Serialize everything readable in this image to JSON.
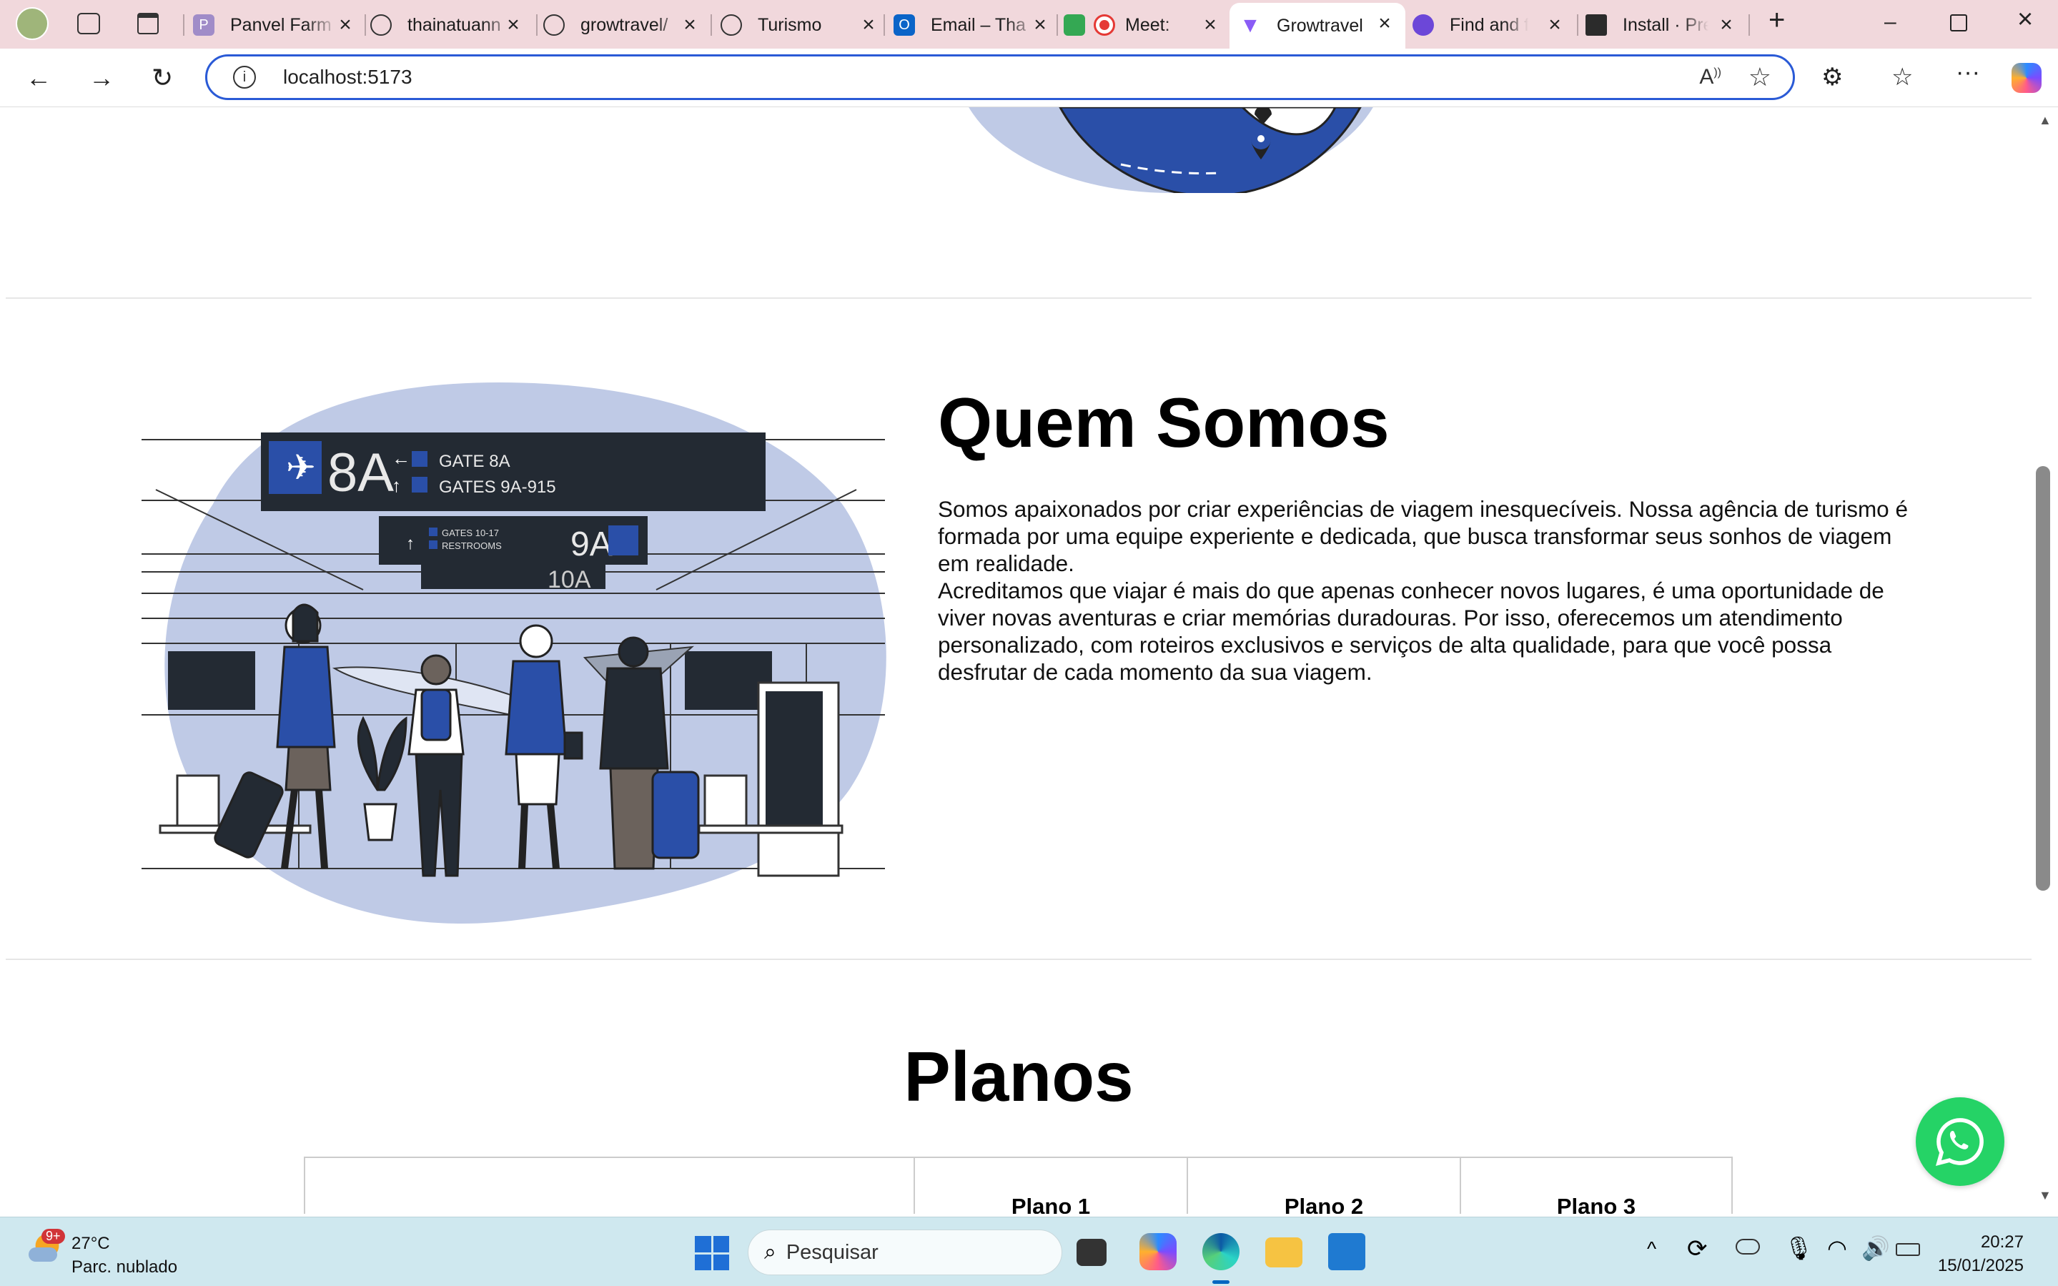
{
  "browser": {
    "tabs": [
      {
        "title": "Panvel Farm",
        "icon": "panvel-icon",
        "color": "#7a5aa6"
      },
      {
        "title": "thainatuann",
        "icon": "github-icon",
        "color": "#222222"
      },
      {
        "title": "growtravel/",
        "icon": "github-icon",
        "color": "#222222"
      },
      {
        "title": "Turismo",
        "icon": "globe-icon",
        "color": "#222222"
      },
      {
        "title": "Email – Tha",
        "icon": "outlook-icon",
        "color": "#0a64c8"
      },
      {
        "title": "Meet:",
        "icon": "meet-icon",
        "color": "#e53935"
      },
      {
        "title": "Growtravel",
        "icon": "vite-icon",
        "color": "#8a5cf6"
      },
      {
        "title": "Find and fix",
        "icon": "copilot-icon",
        "color": "#6c47d8"
      },
      {
        "title": "Install · Pre",
        "icon": "prettier-icon",
        "color": "#2b2b2b"
      }
    ],
    "address": "localhost:5173"
  },
  "page": {
    "about": {
      "title": "Quem Somos",
      "paragraph1": "Somos apaixonados por criar experiências de viagem inesquecíveis. Nossa agência de turismo é formada por uma equipe experiente e dedicada, que busca transformar seus sonhos de viagem em realidade.",
      "paragraph2": "Acreditamos que viajar é mais do que apenas conhecer novos lugares, é uma oportunidade de viver novas aventuras e criar memórias duradouras. Por isso, oferecemos um atendimento personalizado, com roteiros exclusivos e serviços de alta qualidade, para que você possa desfrutar de cada momento da sua viagem."
    },
    "illustration": {
      "gate_main": "8A",
      "gate_line1": "GATE 8A",
      "gate_line2": "GATES 9A-915",
      "gate_small": "9A",
      "gate_small_line1": "GATES 10-17",
      "gate_small_line2": "RESTROOMS",
      "gate_back": "10A"
    },
    "plans": {
      "title": "Planos",
      "columns": [
        "",
        "Plano 1",
        "Plano 2",
        "Plano 3"
      ]
    }
  },
  "taskbar": {
    "weather_temp": "27°C",
    "weather_desc": "Parc. nublado",
    "weather_badge": "9+",
    "search_placeholder": "Pesquisar",
    "time": "20:27",
    "date": "15/01/2025"
  },
  "colors": {
    "accent": "#2a4fa8",
    "blob": "#bfcae6",
    "dark": "#232a33",
    "whatsapp": "#25d366"
  }
}
